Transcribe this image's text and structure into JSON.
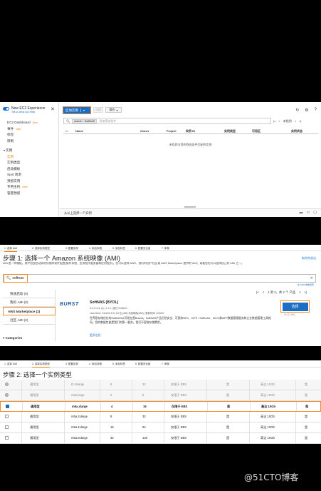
{
  "panel1": {
    "experience_title": "New EC2 Experience",
    "experience_sub": "Tell us what you think",
    "sidebar": {
      "items": [
        {
          "label": "EC2 Dashboard",
          "badge": "New"
        },
        {
          "label": "事件",
          "badge": "New"
        },
        {
          "label": "标签",
          "badge": ""
        },
        {
          "label": "限制",
          "badge": ""
        }
      ],
      "section": "实例",
      "section_items": [
        {
          "label": "实例",
          "badge": "",
          "active": true
        },
        {
          "label": "实例类型",
          "badge": ""
        },
        {
          "label": "启动模板",
          "badge": ""
        },
        {
          "label": "Spot 请求",
          "badge": ""
        },
        {
          "label": "预留实例",
          "badge": ""
        },
        {
          "label": "专用主机",
          "badge": "New"
        },
        {
          "label": "容量预留",
          "badge": ""
        }
      ]
    },
    "toolbar": {
      "launch_label": "启动实例",
      "connect_label": "连接",
      "actions_label": "操作"
    },
    "search": {
      "tag": "search : SoftNAS",
      "placeholder": "添加筛选条件"
    },
    "pager_text": "未找到",
    "columns": [
      "Name",
      "Owner",
      "Project",
      "实例 ID",
      "实例类型",
      "可用区",
      "实例状态"
    ],
    "empty_message": "未找到与您的筛选条件匹配的实例",
    "bottom_text": "从以上选择一个实例"
  },
  "panel2": {
    "steps": [
      "1. 选择 AMI",
      "2. 选择实例类型",
      "3. 配置实例",
      "4. 添加存储",
      "5. 添加标签",
      "6. 配置安全组",
      "7. 审核"
    ],
    "heading": "步骤 1: 选择一个 Amazon 系统映像 (AMI)",
    "cancel_exit": "取消并退出",
    "description": "AMI 是一种模板，其中包含启动实例所需的软件配置(操作系统、应用程序服务器和应用程序)。您可以选择 AWS、我们的用户社区或 AWS Marketplace 提供的 AMI；或者您也可以选择自己的 AMI 之一。",
    "search_value": "softnas",
    "search_note": "在 SSM 参数搜索",
    "categories": [
      "快速启动 (0)",
      "我的 AMI (0)",
      "AWS Marketplace (2)",
      "社区 AMI (0)"
    ],
    "categories_header": "Categories",
    "pager": "1 到 2，共 2 个 产品",
    "ami": {
      "logo": "BURST",
      "title": "SoftNAS (BYOL)",
      "meta": "★★★★★ (6) | 4.4.0 | 通过 SoftNAS",
      "meta2": "Linux/Unix, CentOS 6.9 | 64 位 (x86) 系统映像(AMI) | 更新时间: 2/20/20",
      "text": "世界是存储优化的SoftNAS公司现在是Buurst。SoftNAS产品仍然安全、可靠和NFS、CIFS / SMB-AD、iSCSI和AFP数据管理服务和企业数据管理工具相同。您的数据性能是我们的第一要务。我们不容取存储费用。",
      "more": "更多信息"
    },
    "select_label": "选择",
    "select_sub": "64 位 (x86)"
  },
  "panel3": {
    "steps": [
      "1. 选择 AMI",
      "2. 选择实例类型",
      "3. 配置实例",
      "4. 添加存储",
      "5. 添加标签",
      "6. 配置安全组",
      "7. 审核"
    ],
    "heading": "步骤 2: 选择一个实例类型",
    "rows": [
      {
        "family": "通用型",
        "type": "t3.2xlarge",
        "vcpu": "8",
        "mem": "32",
        "storage": "仅限于 EBS",
        "ebs": "是",
        "net": "高达 10Gb",
        "ipv6": "是",
        "state": "dis"
      },
      {
        "family": "通用型",
        "type": "m5a.large",
        "vcpu": "2",
        "mem": "8",
        "storage": "仅限于 EBS",
        "ebs": "是",
        "net": "高达 10Gb",
        "ipv6": "是",
        "state": "dis"
      },
      {
        "family": "通用型",
        "type": "m5a.xlarge",
        "vcpu": "4",
        "mem": "16",
        "storage": "仅限于 EBS",
        "ebs": "是",
        "net": "高达 10Gb",
        "ipv6": "是",
        "state": "sel"
      },
      {
        "family": "通用型",
        "type": "m5a.2xlarge",
        "vcpu": "8",
        "mem": "32",
        "storage": "仅限于 EBS",
        "ebs": "是",
        "net": "高达 10Gb",
        "ipv6": "是",
        "state": "norm"
      },
      {
        "family": "通用型",
        "type": "m5a.4xlarge",
        "vcpu": "16",
        "mem": "64",
        "storage": "仅限于 EBS",
        "ebs": "是",
        "net": "高达 10Gb",
        "ipv6": "是",
        "state": "norm"
      },
      {
        "family": "通用型",
        "type": "m5a.8xlarge",
        "vcpu": "32",
        "mem": "128",
        "storage": "仅限于 EBS",
        "ebs": "是",
        "net": "高达 10Gb",
        "ipv6": "是",
        "state": "norm"
      }
    ]
  },
  "watermark": "@51CTO博客",
  "colors": {
    "accent": "#f28c28",
    "primary": "#1a6fc4",
    "link": "#1a73d9"
  }
}
